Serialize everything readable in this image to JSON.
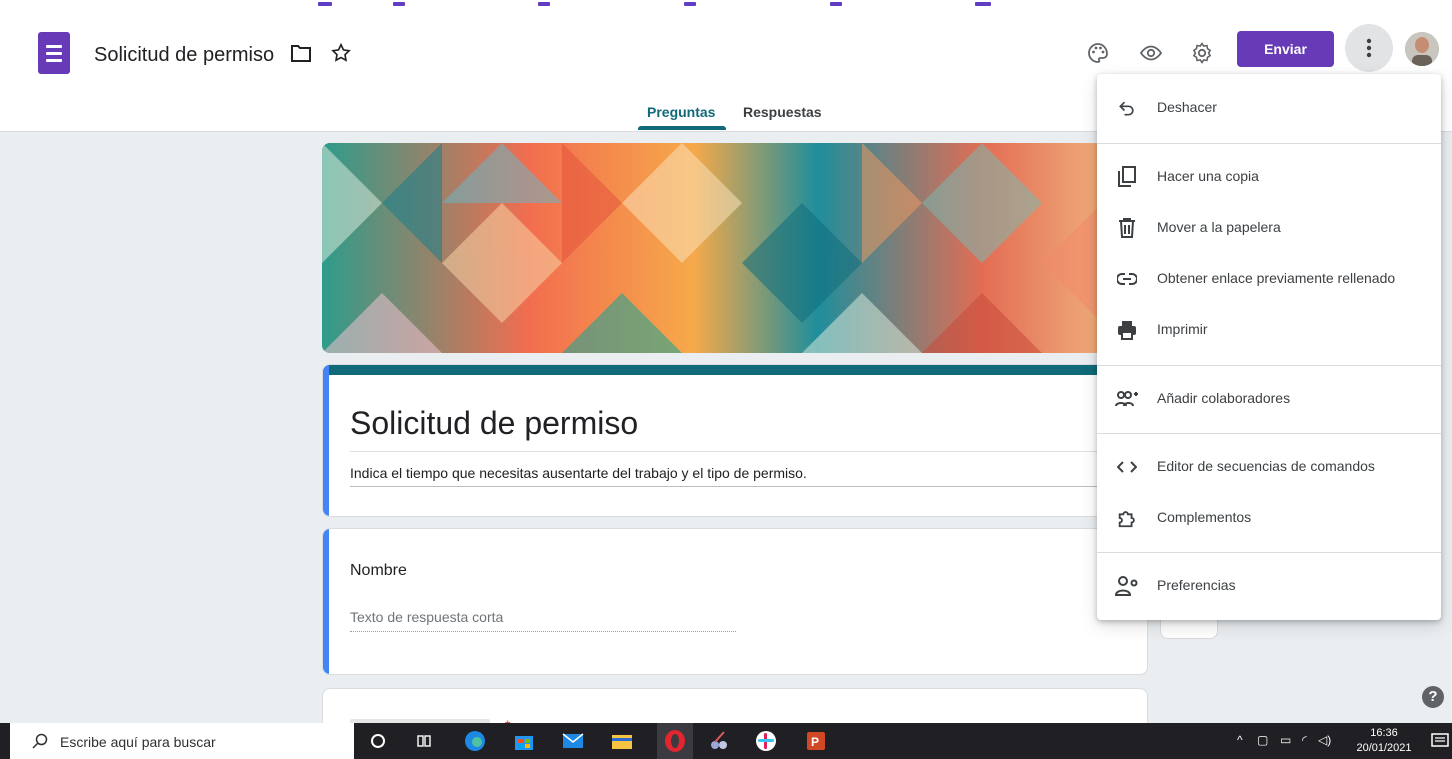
{
  "header": {
    "title": "Solicitud de permiso",
    "send_label": "Enviar"
  },
  "tabs": [
    {
      "label": "Preguntas",
      "active": true
    },
    {
      "label": "Respuestas",
      "active": false
    }
  ],
  "form": {
    "title": "Solicitud de permiso",
    "description": "Indica el tiempo que necesitas ausentarte del trabajo y el tipo de permiso.",
    "questions": [
      {
        "label": "Nombre",
        "placeholder": "Texto de respuesta corta"
      }
    ]
  },
  "menu": {
    "items": [
      {
        "label": "Deshacer",
        "icon": "undo-icon"
      },
      {
        "label": "Hacer una copia",
        "icon": "copy-icon"
      },
      {
        "label": "Mover a la papelera",
        "icon": "trash-icon"
      },
      {
        "label": "Obtener enlace previamente rellenado",
        "icon": "link-icon"
      },
      {
        "label": "Imprimir",
        "icon": "print-icon"
      },
      {
        "label": "Añadir colaboradores",
        "icon": "add-people-icon"
      },
      {
        "label": "Editor de secuencias de comandos",
        "icon": "code-icon"
      },
      {
        "label": "Complementos",
        "icon": "puzzle-icon"
      },
      {
        "label": "Preferencias",
        "icon": "person-settings-icon"
      }
    ]
  },
  "taskbar": {
    "search_placeholder": "Escribe aquí para buscar",
    "time": "16:36",
    "date": "20/01/2021"
  },
  "colors": {
    "brand": "#673ab7",
    "accent": "#116a79",
    "question_bar": "#4285f4"
  }
}
